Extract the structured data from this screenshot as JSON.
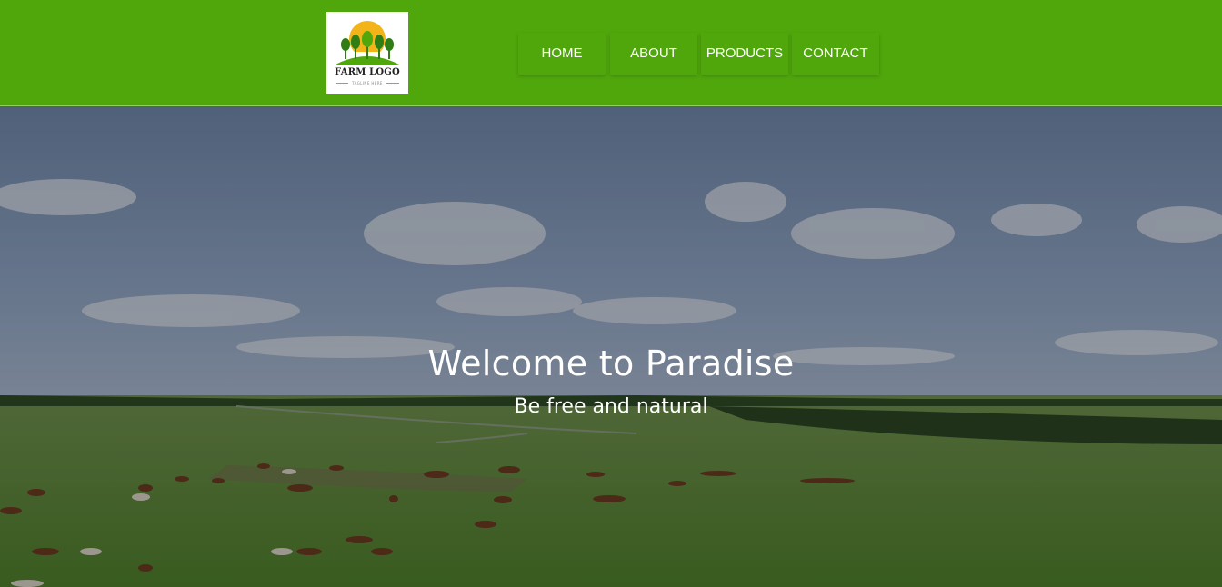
{
  "header": {
    "background_color": "#4fa70b",
    "logo": {
      "title": "FARM LOGO",
      "tagline": "TAGLINE HERE",
      "icon": "farm-logo-trees-sun",
      "sun_color": "#f2b418",
      "tree_color": "#2f7d14"
    },
    "nav": [
      {
        "label": "HOME"
      },
      {
        "label": "ABOUT"
      },
      {
        "label": "PRODUCTS"
      },
      {
        "label": "CONTACT"
      }
    ]
  },
  "hero": {
    "title": "Welcome to Paradise",
    "subtitle": "Be free and natural",
    "background_image": "aerial-view-horses-grazing-meadow"
  }
}
